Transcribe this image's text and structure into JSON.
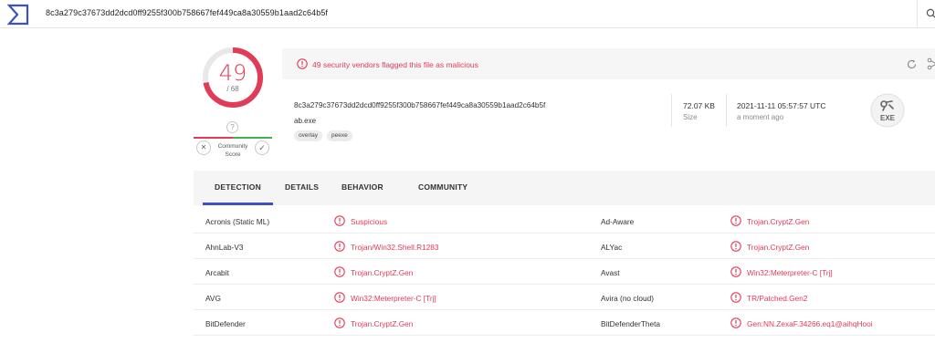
{
  "search": {
    "query": "8c3a279c37673dd2dcd0ff9255f300b758667fef449ca8a30559b1aad2c64b5f"
  },
  "score": {
    "detections": "49",
    "total": "/ 68"
  },
  "community": {
    "unknown_mark": "?",
    "label_line1": "Community",
    "label_line2": "Score",
    "vote_down": "✕",
    "vote_up": "✓"
  },
  "banner": {
    "text": "49 security vendors flagged this file as malicious"
  },
  "file": {
    "hash": "8c3a279c37673dd2dcd0ff9255f300b758667fef449ca8a30559b1aad2c64b5f",
    "name": "ab.exe",
    "tags": [
      "overlay",
      "peexe"
    ],
    "size_value": "72.07 KB",
    "size_label": "Size",
    "date_value": "2021-11-11 05:57:57 UTC",
    "date_ago": "a moment ago",
    "type_icon_label": "EXE"
  },
  "tabs": [
    "DETECTION",
    "DETAILS",
    "BEHAVIOR",
    "COMMUNITY"
  ],
  "detections": [
    {
      "left_vendor": "Acronis (Static ML)",
      "left_result": "Suspicious",
      "right_vendor": "Ad-Aware",
      "right_result": "Trojan.CryptZ.Gen"
    },
    {
      "left_vendor": "AhnLab-V3",
      "left_result": "Trojan/Win32.Shell.R1283",
      "right_vendor": "ALYac",
      "right_result": "Trojan.CryptZ.Gen"
    },
    {
      "left_vendor": "Arcabit",
      "left_result": "Trojan.CryptZ.Gen",
      "right_vendor": "Avast",
      "right_result": "Win32:Meterpreter-C [Trj]"
    },
    {
      "left_vendor": "AVG",
      "left_result": "Win32:Meterpreter-C [Trj]",
      "right_vendor": "Avira (no cloud)",
      "right_result": "TR/Patched.Gen2"
    },
    {
      "left_vendor": "BitDefender",
      "left_result": "Trojan.CryptZ.Gen",
      "right_vendor": "BitDefenderTheta",
      "right_result": "Gen:NN.ZexaF.34266.eq1@aihqHooi"
    }
  ],
  "colors": {
    "malicious": "#e03c57",
    "accent": "#3a52c8",
    "safe": "#3eb34f"
  }
}
